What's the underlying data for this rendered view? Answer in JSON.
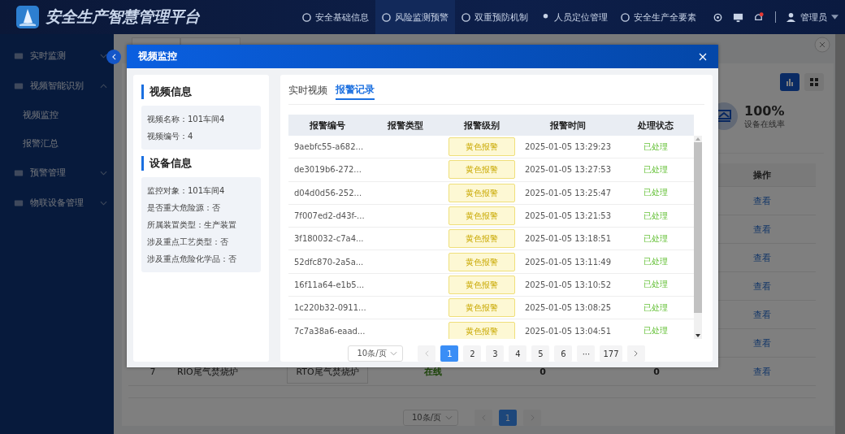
{
  "header": {
    "title": "安全生产智慧管理平台",
    "nav": [
      {
        "label": "安全基础信息",
        "selected": false
      },
      {
        "label": "风险监测预警",
        "selected": true
      },
      {
        "label": "双重预防机制",
        "selected": false
      },
      {
        "label": "人员定位管理",
        "selected": false
      },
      {
        "label": "安全生产全要素",
        "selected": false
      }
    ],
    "notification": true,
    "user": "管理员"
  },
  "sidebar": {
    "items": [
      {
        "label": "实时监测",
        "expanded": false
      },
      {
        "label": "视频智能识别",
        "expanded": true,
        "children": [
          {
            "label": "视频监控"
          },
          {
            "label": "报警汇总"
          }
        ]
      },
      {
        "label": "预警管理",
        "expanded": false
      },
      {
        "label": "物联设备管理",
        "expanded": false
      }
    ]
  },
  "stat": {
    "value": "100%",
    "label": "设备在线率"
  },
  "view_toggle": [
    {
      "selected": true
    },
    {
      "selected": false
    }
  ],
  "table": {
    "columns": [
      "操作"
    ],
    "rows": [
      {
        "cells": [],
        "action": "查看"
      },
      {
        "cells": [],
        "action": "查看"
      },
      {
        "cells": [],
        "action": "查看"
      },
      {
        "cells": [],
        "action": "查看"
      },
      {
        "cells": [],
        "action": "查看"
      },
      {
        "cells": [],
        "action": "查看"
      },
      {
        "cells": [
          "7",
          "RIO尾气焚烧炉",
          "RTO尾气焚烧炉",
          "在线",
          "0",
          "0"
        ],
        "action": "查看"
      }
    ]
  },
  "pagination": {
    "page_size": "10条/页",
    "pages": [
      {
        "label": "1",
        "selected": true
      }
    ]
  },
  "modal": {
    "title": "视频监控",
    "sections": [
      {
        "title": "视频信息",
        "fields": [
          "视频名称：101车间4",
          "视频编号：4"
        ]
      },
      {
        "title": "设备信息",
        "fields": [
          "监控对象：101车间4",
          "是否重大危险源：否",
          "所属装置类型：生产装置",
          "涉及重点工艺类型：否",
          "涉及重点危险化学品：否"
        ]
      }
    ],
    "tabs": [
      {
        "label": "实时视频",
        "selected": false
      },
      {
        "label": "报警记录",
        "selected": true
      }
    ],
    "columns": [
      "报警编号",
      "报警类型",
      "报警级别",
      "报警时间",
      "处理状态"
    ],
    "rows": [
      {
        "id": "9aebfc55-a682...",
        "type": "",
        "level": "黄色报警",
        "time": "2025-01-05 13:29:23",
        "status": "已处理"
      },
      {
        "id": "de3019b6-272...",
        "type": "",
        "level": "黄色报警",
        "time": "2025-01-05 13:27:53",
        "status": "已处理"
      },
      {
        "id": "d04d0d56-252...",
        "type": "",
        "level": "黄色报警",
        "time": "2025-01-05 13:25:47",
        "status": "已处理"
      },
      {
        "id": "7f007ed2-d43f-...",
        "type": "",
        "level": "黄色报警",
        "time": "2025-01-05 13:21:53",
        "status": "已处理"
      },
      {
        "id": "3f180032-c7a4...",
        "type": "",
        "level": "黄色报警",
        "time": "2025-01-05 13:18:51",
        "status": "已处理"
      },
      {
        "id": "52dfc870-2a5a...",
        "type": "",
        "level": "黄色报警",
        "time": "2025-01-05 13:11:49",
        "status": "已处理"
      },
      {
        "id": "16f11a64-e1b5...",
        "type": "",
        "level": "黄色报警",
        "time": "2025-01-05 13:10:52",
        "status": "已处理"
      },
      {
        "id": "1c220b32-0911...",
        "type": "",
        "level": "黄色报警",
        "time": "2025-01-05 13:08:25",
        "status": "已处理"
      },
      {
        "id": "7c7a38a6-eaad...",
        "type": "",
        "level": "黄色报警",
        "time": "2025-01-05 13:04:51",
        "status": "已处理"
      }
    ],
    "pagination": {
      "page_size": "10条/页",
      "pages": [
        {
          "label": "1",
          "selected": true
        },
        {
          "label": "2",
          "selected": false
        },
        {
          "label": "3",
          "selected": false
        },
        {
          "label": "4",
          "selected": false
        },
        {
          "label": "5",
          "selected": false
        },
        {
          "label": "6",
          "selected": false
        },
        {
          "label": "···",
          "selected": false
        },
        {
          "label": "177",
          "selected": false
        }
      ]
    }
  }
}
